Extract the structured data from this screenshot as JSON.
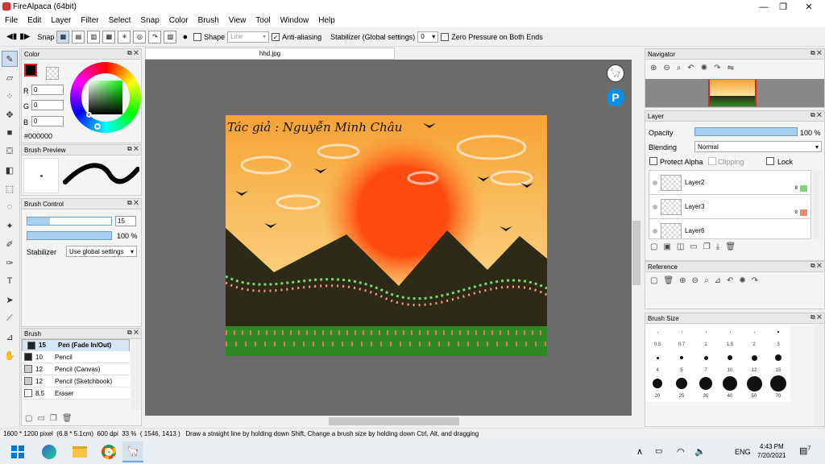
{
  "app": {
    "title": "FireAlpaca (64bit)"
  },
  "menu": [
    "File",
    "Edit",
    "Layer",
    "Filter",
    "Select",
    "Snap",
    "Color",
    "Brush",
    "View",
    "Tool",
    "Window",
    "Help"
  ],
  "toolbar": {
    "snap_label": "Snap",
    "shape_label": "Shape",
    "shape_value": "Line",
    "antialias_label": "Anti-aliasing",
    "stabilizer_label": "Stabilizer (Global settings)",
    "stabilizer_value": "0",
    "zero_pressure_label": "Zero Pressure on Both Ends"
  },
  "color_panel": {
    "title": "Color",
    "r_label": "R",
    "r": "0",
    "g_label": "G",
    "g": "0",
    "b_label": "B",
    "b": "0",
    "hex": "#000000"
  },
  "brush_preview": {
    "title": "Brush Preview"
  },
  "brush_control": {
    "title": "Brush Control",
    "size": "15",
    "opacity": "100 %",
    "size_fraction": 0.27,
    "opacity_fraction": 1.0,
    "stabilizer_label": "Stabilizer",
    "stabilizer_value": "Use global settings"
  },
  "brush_panel": {
    "title": "Brush",
    "items": [
      {
        "size": "15",
        "name": "Pen (Fade In/Out)",
        "selected": true
      },
      {
        "size": "10",
        "name": "Pencil",
        "selected": false
      },
      {
        "size": "12",
        "name": "Pencil (Canvas)",
        "selected": false
      },
      {
        "size": "12",
        "name": "Pencil (Sketchbook)",
        "selected": false
      },
      {
        "size": "8.5",
        "name": "Eraser",
        "selected": false
      }
    ]
  },
  "document": {
    "tab": "hhd.jpg",
    "caption": "Tác giả : Nguyễn Minh Châu",
    "colors": {
      "sky_top": "#f6a335",
      "sky_bottom": "#fde5a0",
      "sun": "#ff4a10",
      "mountain": "#2d2b17",
      "grass": "#2f8a25"
    }
  },
  "navigator": {
    "title": "Navigator"
  },
  "layer_panel": {
    "title": "Layer",
    "opacity_label": "Opacity",
    "opacity_value": "100 %",
    "blending_label": "Blending",
    "blending_value": "Normal",
    "protect_alpha": "Protect Alpha",
    "clipping": "Clipping",
    "lock": "Lock",
    "layers": [
      {
        "name": "Layer2",
        "badge": "8",
        "color": "#7fd67a"
      },
      {
        "name": "Layer3",
        "badge": "8",
        "color": "#f08a70"
      },
      {
        "name": "Layer6",
        "badge": "",
        "color": ""
      }
    ]
  },
  "reference_panel": {
    "title": "Reference"
  },
  "brush_size_panel": {
    "title": "Brush Size",
    "sizes": [
      "0.5",
      "0.7",
      "1",
      "1.5",
      "2",
      "3",
      "4",
      "5",
      "7",
      "10",
      "12",
      "15",
      "20",
      "25",
      "30",
      "40",
      "50",
      "70"
    ]
  },
  "status": {
    "dimensions": "1600 * 1200 pixel",
    "physical": "(6.8 * 5.1cm)",
    "dpi": "600 dpi",
    "zoom": "33 %",
    "coords": "( 1546, 1413 )",
    "hint": "Draw a straight line by holding down Shift, Change a brush size by holding down Ctrl, Alt, and dragging"
  },
  "taskbar": {
    "lang": "ENG",
    "time": "4:43 PM",
    "date": "7/20/2021",
    "notification_count": "7"
  }
}
